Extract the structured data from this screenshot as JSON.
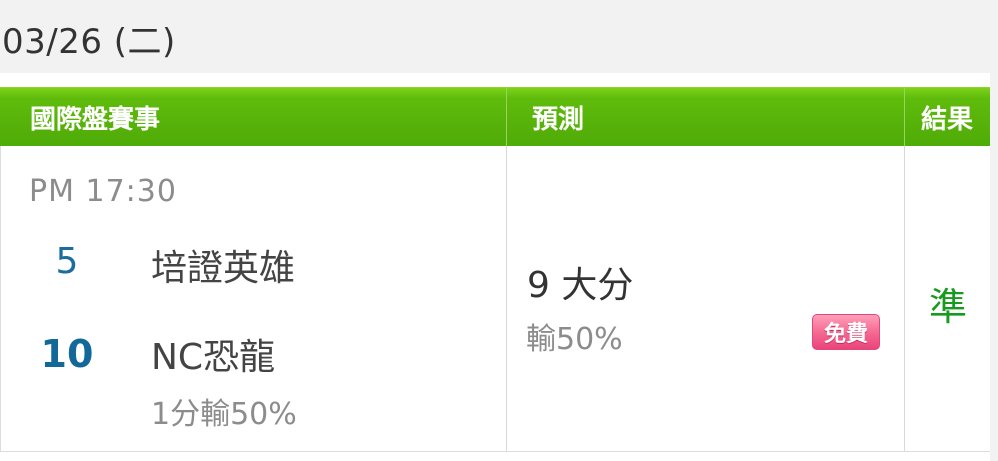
{
  "date": {
    "label": "03/26 (二)"
  },
  "table": {
    "headers": {
      "event": "國際盤賽事",
      "predict": "預測",
      "result": "結果"
    },
    "row": {
      "time": "PM 17:30",
      "team_a": {
        "rank": "5",
        "name": "培證英雄"
      },
      "team_b": {
        "rank": "10",
        "name": "NC恐龍"
      },
      "handicap": "1分輸50%",
      "prediction": {
        "pick": "9 大分",
        "sub": "輸50%"
      },
      "badge": "免費",
      "result": "準"
    }
  },
  "colors": {
    "header_green": "#4fab07",
    "rank_blue": "#13689a",
    "result_green": "#189a1f",
    "badge_pink": "#f56a93"
  }
}
